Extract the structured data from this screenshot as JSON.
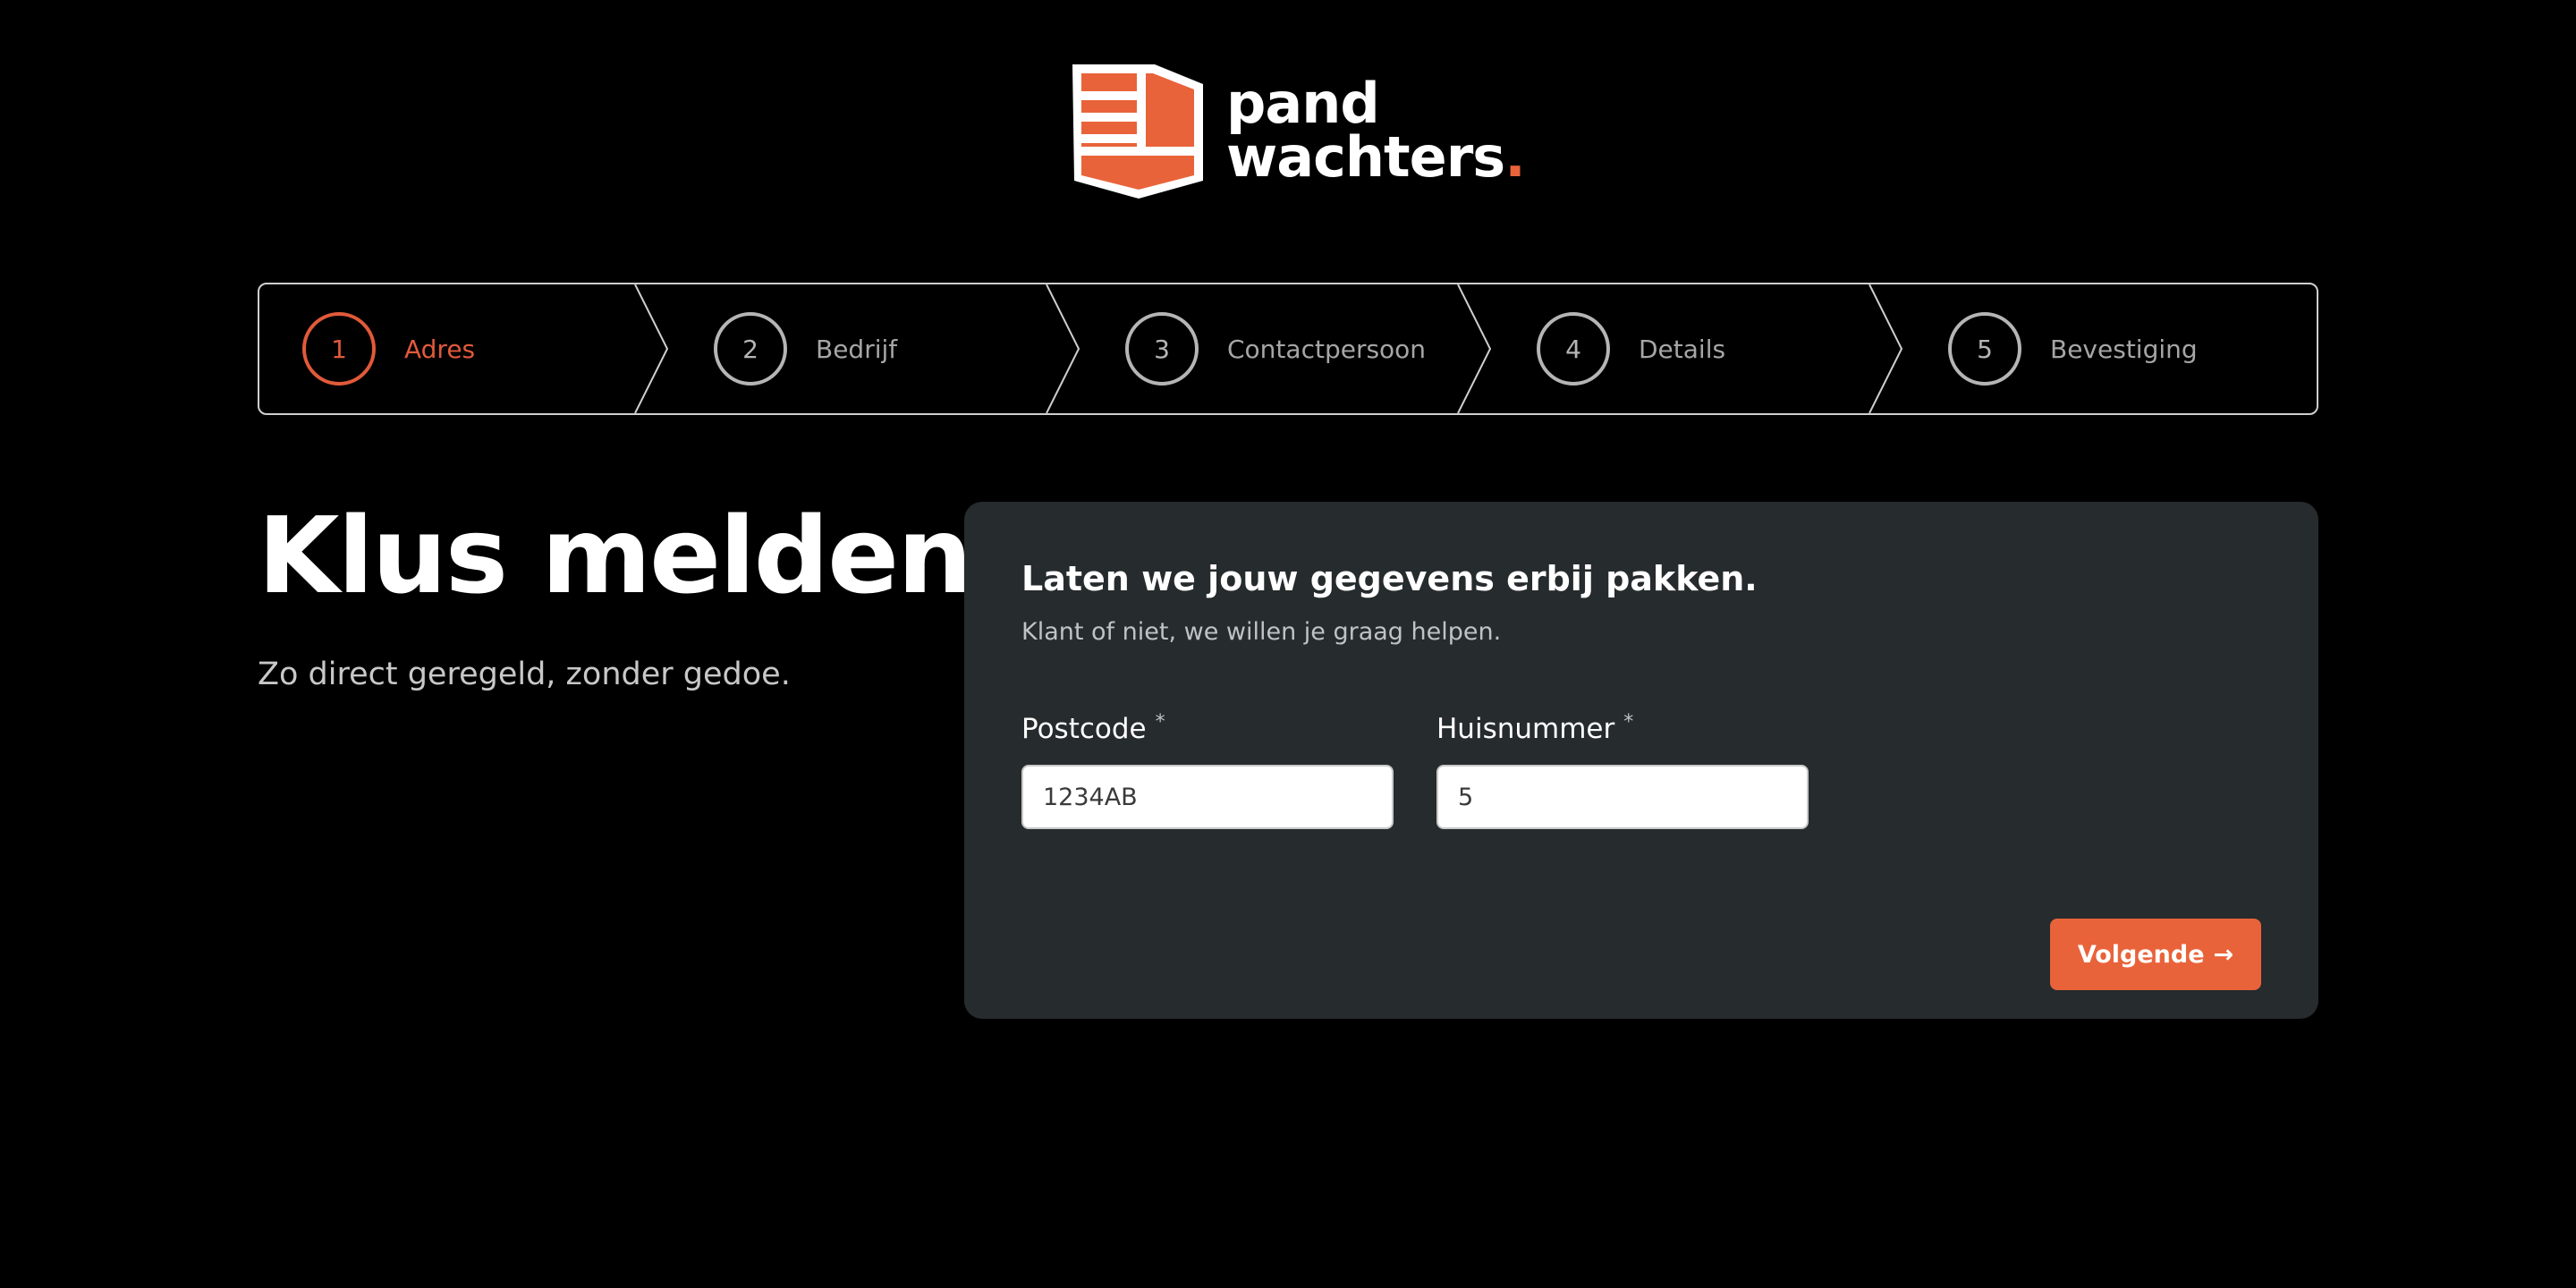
{
  "brand": {
    "name_line1": "pand",
    "name_line2": "wachters",
    "name_dot": ".",
    "logo_icon": "building-shield-icon",
    "accent_color": "#e9633a"
  },
  "stepper": {
    "steps": [
      {
        "number": "1",
        "label": "Adres",
        "active": true
      },
      {
        "number": "2",
        "label": "Bedrijf",
        "active": false
      },
      {
        "number": "3",
        "label": "Contactpersoon",
        "active": false
      },
      {
        "number": "4",
        "label": "Details",
        "active": false
      },
      {
        "number": "5",
        "label": "Bevestiging",
        "active": false
      }
    ]
  },
  "hero": {
    "title": "Klus melden",
    "subtitle": "Zo direct geregeld, zonder gedoe."
  },
  "form": {
    "title": "Laten we jouw gegevens erbij pakken.",
    "subtitle": "Klant of niet, we willen je graag helpen.",
    "postcode": {
      "label": "Postcode",
      "required_mark": "*",
      "value": "1234AB"
    },
    "huisnummer": {
      "label": "Huisnummer",
      "required_mark": "*",
      "value": "5"
    },
    "next_button": {
      "label": "Volgende",
      "icon": "arrow-right-icon",
      "glyph": "→"
    }
  }
}
